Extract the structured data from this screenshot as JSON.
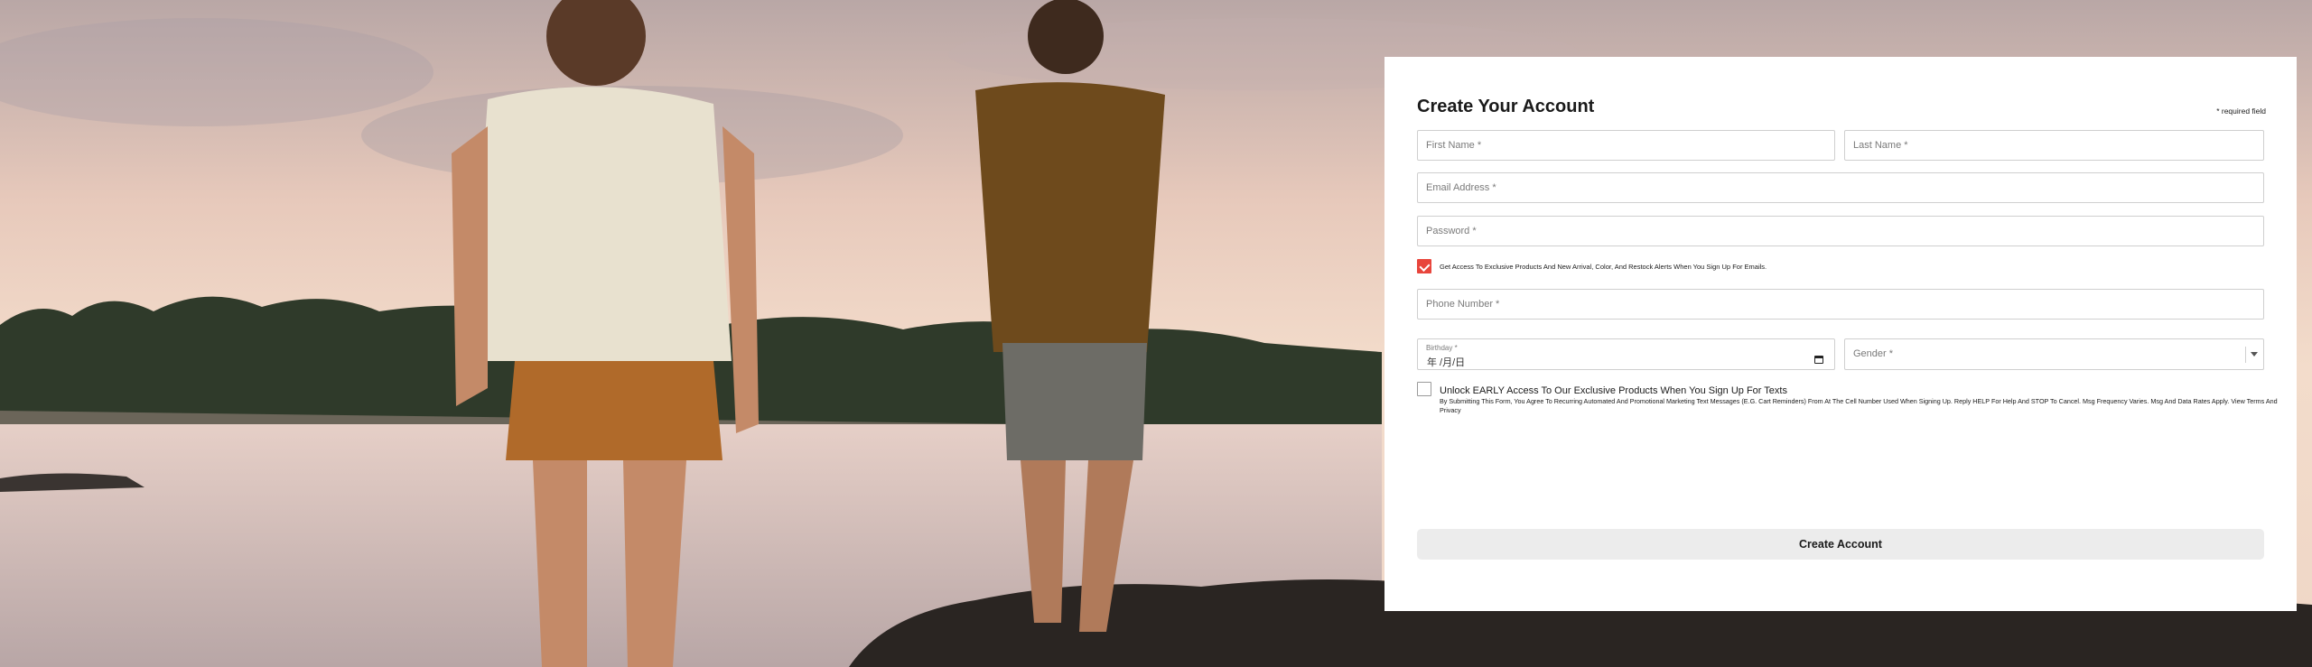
{
  "form": {
    "title": "Create Your Account",
    "required_note": "* required field",
    "first_name": {
      "placeholder": "First Name *",
      "value": ""
    },
    "last_name": {
      "placeholder": "Last Name *",
      "value": ""
    },
    "email": {
      "placeholder": "Email Address *",
      "value": ""
    },
    "password": {
      "placeholder": "Password *",
      "value": ""
    },
    "email_opt_in": {
      "checked": true,
      "label": "Get Access To Exclusive Products And New Arrival, Color, And Restock Alerts When You Sign Up For Emails."
    },
    "phone": {
      "placeholder": "Phone Number *",
      "value": ""
    },
    "birthday": {
      "label": "Birthday *",
      "value": "年 /月/日"
    },
    "gender": {
      "placeholder": "Gender *"
    },
    "text_opt_in": {
      "checked": false,
      "label": "Unlock EARLY Access To Our Exclusive Products When You Sign Up For Texts",
      "legal": "By Submitting This Form, You Agree To Recurring Automated And Promotional Marketing Text Messages (E.G. Cart Reminders) From At The Cell Number Used When Signing Up. Reply HELP For Help And STOP To Cancel. Msg Frequency Varies. Msg And Data Rates Apply. View Terms And Privacy"
    },
    "submit_label": "Create Account"
  },
  "colors": {
    "accent_checkbox": "#e8453c",
    "button_bg": "#ececec",
    "panel_bg": "#ffffff"
  }
}
